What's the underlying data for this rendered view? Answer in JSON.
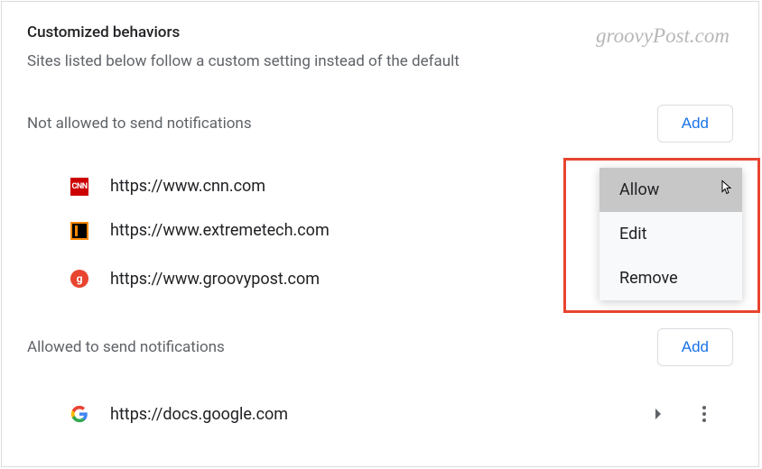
{
  "title": "Customized behaviors",
  "subtitle": "Sites listed below follow a custom setting instead of the default",
  "watermark": "groovyPost.com",
  "sections": {
    "blocked": {
      "label": "Not allowed to send notifications",
      "addButton": "Add",
      "items": [
        {
          "url": "https://www.cnn.com",
          "favicon": "cnn"
        },
        {
          "url": "https://www.extremetech.com",
          "favicon": "et"
        },
        {
          "url": "https://www.groovypost.com",
          "favicon": "gp"
        }
      ]
    },
    "allowed": {
      "label": "Allowed to send notifications",
      "addButton": "Add",
      "items": [
        {
          "url": "https://docs.google.com",
          "favicon": "g"
        }
      ]
    }
  },
  "contextMenu": {
    "items": [
      "Allow",
      "Edit",
      "Remove"
    ],
    "highlightedIndex": 0
  }
}
